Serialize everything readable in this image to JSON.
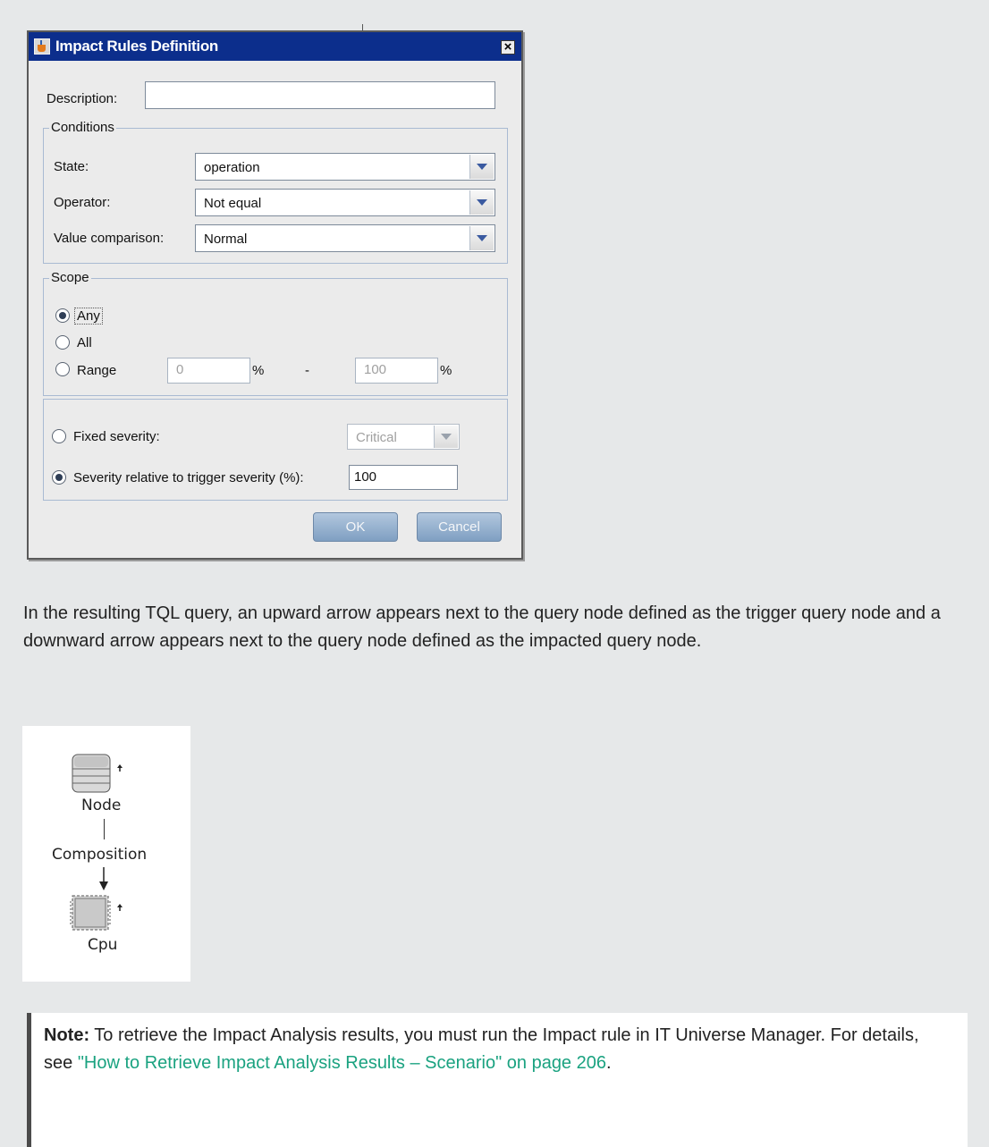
{
  "dialog": {
    "title": "Impact Rules Definition",
    "close_glyph": "×",
    "description_label": "Description:",
    "description_value": "",
    "conditions": {
      "title": "Conditions",
      "state_label": "State:",
      "state_value": "operation",
      "operator_label": "Operator:",
      "operator_value": "Not equal",
      "value_comparison_label": "Value comparison:",
      "value_comparison_value": "Normal"
    },
    "scope": {
      "title": "Scope",
      "any_label": "Any",
      "all_label": "All",
      "range_label": "Range",
      "selected": "Any",
      "range_from": "0",
      "range_to": "100",
      "percent_symbol": "%",
      "dash": "-"
    },
    "severity": {
      "fixed_label": "Fixed severity:",
      "fixed_value": "Critical",
      "relative_label": "Severity relative to trigger severity (%):",
      "relative_value": "100",
      "selected": "relative"
    },
    "ok_label": "OK",
    "cancel_label": "Cancel"
  },
  "paragraph": "In the resulting TQL query, an upward arrow appears next to the query node defined as the trigger query node and a downward arrow appears next to the query node defined as the impacted query node.",
  "tql": {
    "node_top_label": "Node",
    "edge_label": "Composition",
    "node_bottom_label": "Cpu"
  },
  "note": {
    "label": "Note:",
    "text": " To retrieve the Impact Analysis results, you must run the Impact rule in IT Universe Manager. For details, see ",
    "link_text": "\"How to Retrieve Impact Analysis Results – Scenario\" on page 206",
    "end": "."
  },
  "colors": {
    "titlebar": "#0c2e8c",
    "link": "#1aa280",
    "button": "#8fadcf"
  }
}
